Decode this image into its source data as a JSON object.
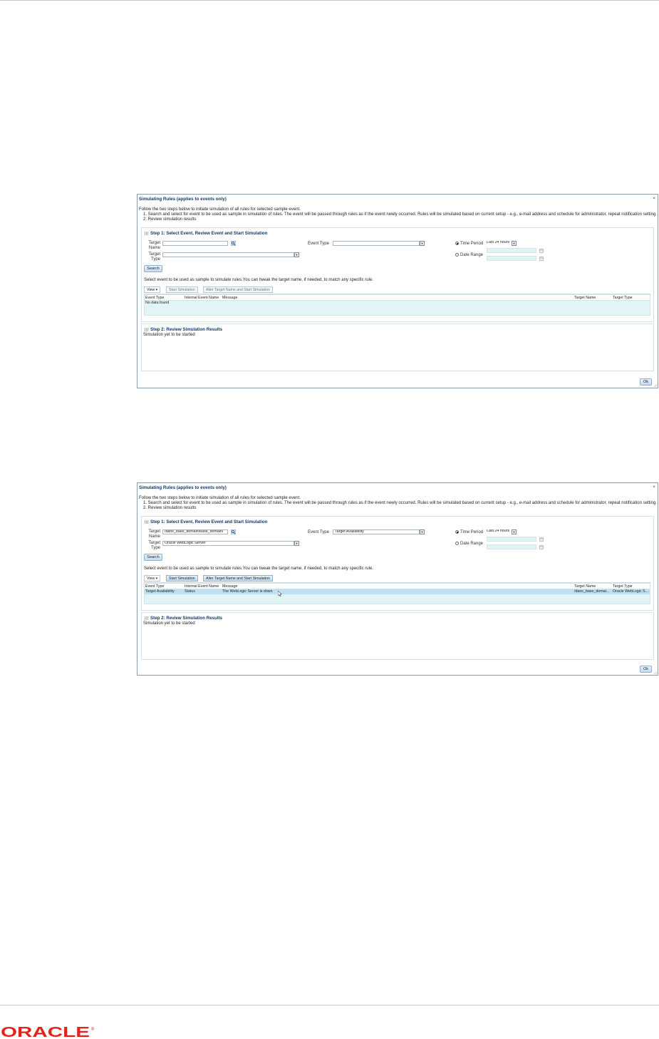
{
  "dialog_common": {
    "title": "Simulating Rules (applies to events only)",
    "close_label": "×",
    "intro": "Follow the two steps below to initiate simulation of all rules for selected sample event.",
    "steps": [
      "1.   Search and select for event to be used as sample in simulation of rules. The event will be passed through rules as if the event newly occurred. Rules will be simulated based on current setup - e.g., e-mail address and schedule for administrator, repeat notification setting.",
      "2.   Review simulation results"
    ],
    "step1_title": "Step 1: Select Event, Review Event and Start Simulation",
    "step2_title": "Step 2: Review Simulation Results",
    "labels": {
      "target_name_1": "Target",
      "target_name_2": "Name",
      "target_type_1": "Target",
      "target_type_2": "Type",
      "event_type": "Event Type",
      "time_period": "Time Period",
      "date_range": "Date Range"
    },
    "search_button": "Search",
    "select_hint": "Select event to be used as sample to simulate rules.You can tweak the target name, if needed, to match any specific rule.",
    "toolbar": {
      "view": "View ▾",
      "start_simulation": "Start Simulation",
      "alter_start": "Alter Target Name and Start Simulation"
    },
    "columns": [
      "Event Type",
      "Internal Event Name",
      "Message",
      "Target Name",
      "Target Type"
    ],
    "simulation_status": "Simulation yet to be started",
    "ok_button": "Ok"
  },
  "dialog1": {
    "target_name_value": "",
    "target_type_value": "",
    "event_type_value": "",
    "time_period_value": "Last 24 hours",
    "time_period_selected": true,
    "empty_message": "No data found",
    "toolbar_buttons_enabled": false
  },
  "dialog2": {
    "target_name_value": "/dans_base_domain/base_domain/",
    "target_type_value": "Oracle WebLogic Server",
    "event_type_value": "Target Availability",
    "time_period_value": "Last 24 hours",
    "time_period_selected": true,
    "toolbar_buttons_enabled": true,
    "rows": [
      {
        "event_type": "Target Availability",
        "internal_event_name": "Status",
        "message": "The WebLogic Server is down",
        "target_name": "/dans_base_domai...",
        "target_type": "Oracle WebLogic S..."
      }
    ]
  },
  "footer": {
    "logo_text": "ORACLE",
    "logo_mark": "®",
    "logo_color": "#e2231a"
  },
  "colors": {
    "title_text": "#14396a",
    "grid_fill": "#e2f4f6",
    "selected_row": "#bfe0f2",
    "button_border": "#8fb0cc"
  }
}
